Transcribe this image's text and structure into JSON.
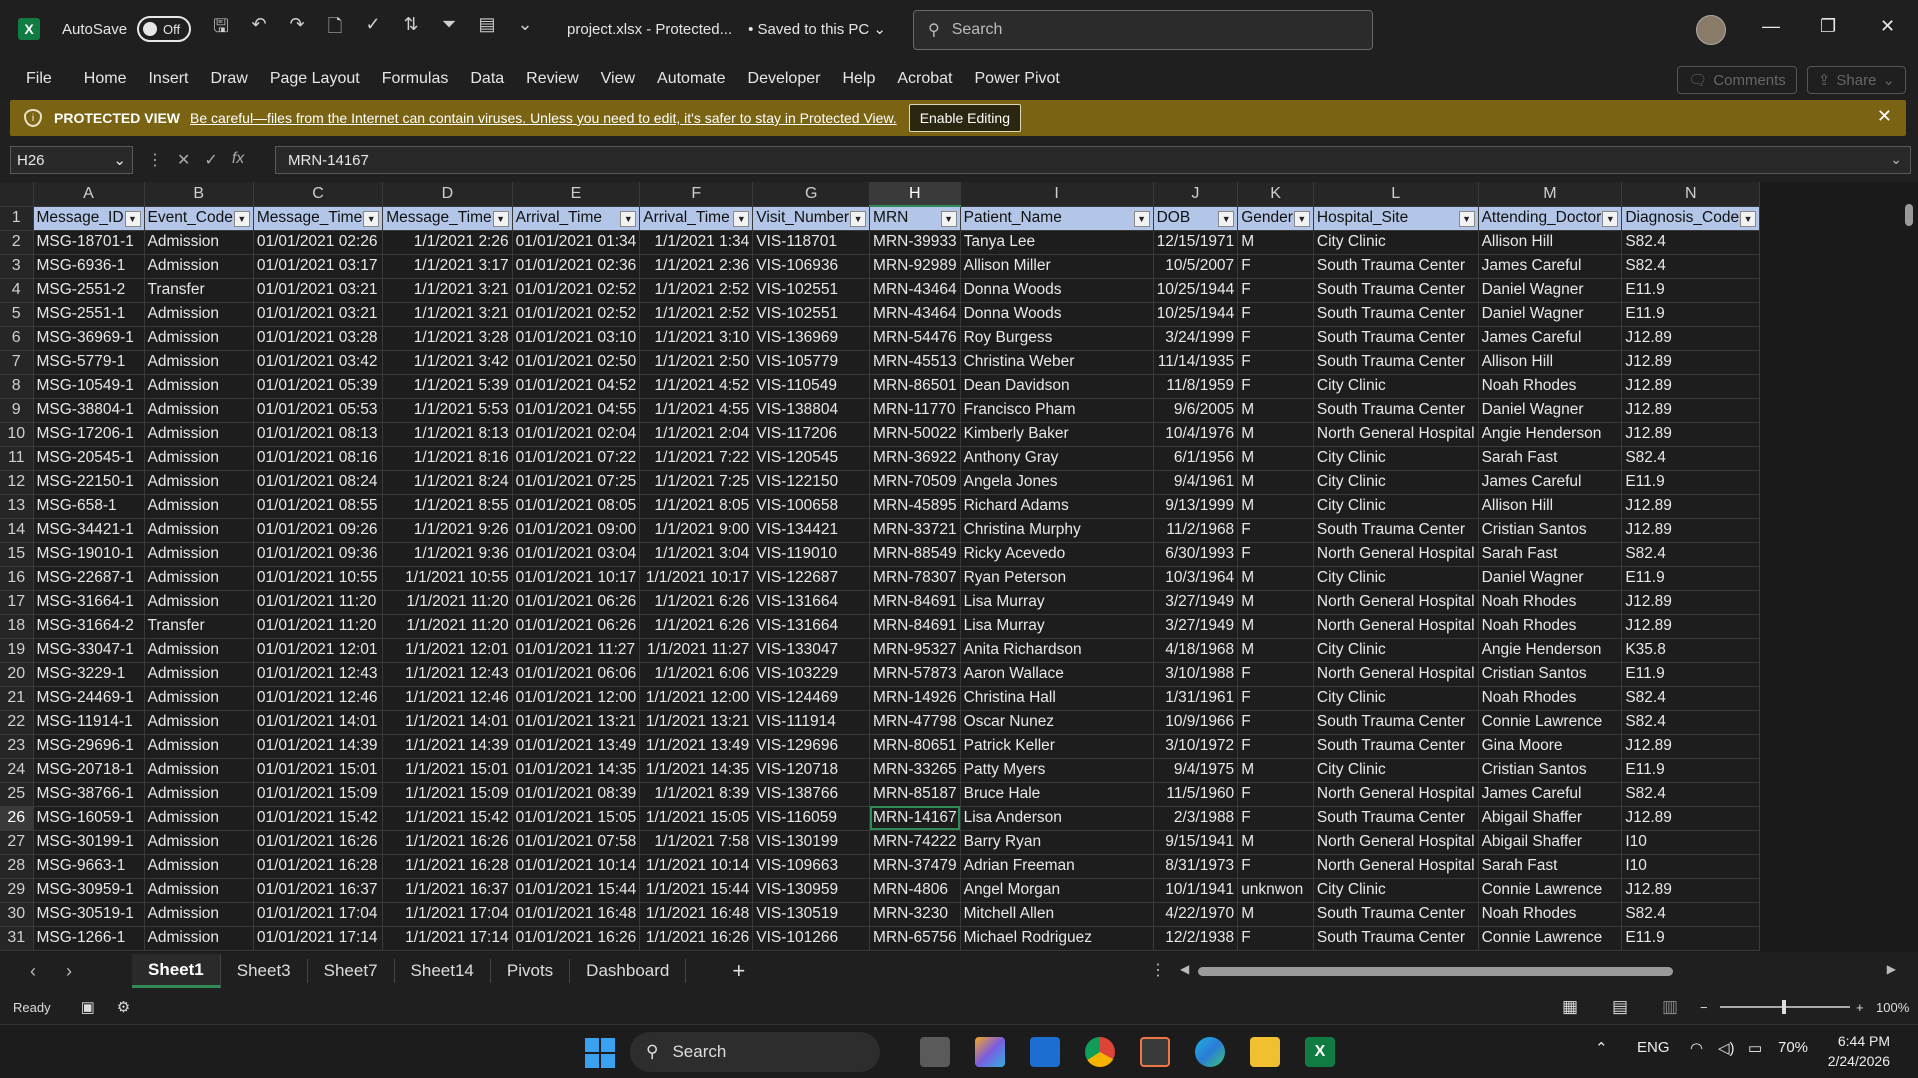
{
  "titlebar": {
    "autosave_label": "AutoSave",
    "autosave_state": "Off",
    "filename": "project.xlsx  -  Protected...",
    "save_status": "•  Saved to this PC ⌄",
    "search_placeholder": "Search",
    "minimize_icon": "—",
    "restore_icon": "❐",
    "close_icon": "✕"
  },
  "menu": [
    "File",
    "Home",
    "Insert",
    "Draw",
    "Page Layout",
    "Formulas",
    "Data",
    "Review",
    "View",
    "Automate",
    "Developer",
    "Help",
    "Acrobat",
    "Power Pivot"
  ],
  "menu_buttons": {
    "comments": "Comments",
    "share": "Share"
  },
  "protected_view": {
    "title": "PROTECTED VIEW",
    "message": "Be careful—files from the Internet can contain viruses. Unless you need to edit, it's safer to stay in Protected View.",
    "button": "Enable Editing",
    "bg_color": "#7a6312"
  },
  "formula_bar": {
    "name_box": "H26",
    "fx": "fx",
    "value": "MRN-14167"
  },
  "columns": [
    "A",
    "B",
    "C",
    "D",
    "E",
    "F",
    "G",
    "H",
    "I",
    "J",
    "K",
    "L",
    "M",
    "N"
  ],
  "selected_column": "H",
  "header_row": [
    "Message_ID",
    "Event_Code",
    "Message_Time",
    "Message_Time",
    "Arrival_Time",
    "Arrival_Time",
    "Visit_Number",
    "MRN",
    "Patient_Name",
    "DOB",
    "Gender",
    "Hospital_Site",
    "Attending_Doctor",
    "Diagnosis_Code"
  ],
  "rows": [
    [
      "MSG-18701-1",
      "Admission",
      "01/01/2021 02:26",
      "1/1/2021 2:26",
      "01/01/2021 01:34",
      "1/1/2021 1:34",
      "VIS-118701",
      "MRN-39933",
      "Tanya Lee",
      "12/15/1971",
      "M",
      "City Clinic",
      "Allison Hill",
      "S82.4"
    ],
    [
      "MSG-6936-1",
      "Admission",
      "01/01/2021 03:17",
      "1/1/2021 3:17",
      "01/01/2021 02:36",
      "1/1/2021 2:36",
      "VIS-106936",
      "MRN-92989",
      "Allison Miller",
      "10/5/2007",
      "F",
      "South Trauma Center",
      "James Careful",
      "S82.4"
    ],
    [
      "MSG-2551-2",
      "Transfer",
      "01/01/2021 03:21",
      "1/1/2021 3:21",
      "01/01/2021 02:52",
      "1/1/2021 2:52",
      "VIS-102551",
      "MRN-43464",
      "Donna Woods",
      "10/25/1944",
      "F",
      "South Trauma Center",
      "Daniel Wagner",
      "E11.9"
    ],
    [
      "MSG-2551-1",
      "Admission",
      "01/01/2021 03:21",
      "1/1/2021 3:21",
      "01/01/2021 02:52",
      "1/1/2021 2:52",
      "VIS-102551",
      "MRN-43464",
      "Donna Woods",
      "10/25/1944",
      "F",
      "South Trauma Center",
      "Daniel Wagner",
      "E11.9"
    ],
    [
      "MSG-36969-1",
      "Admission",
      "01/01/2021 03:28",
      "1/1/2021 3:28",
      "01/01/2021 03:10",
      "1/1/2021 3:10",
      "VIS-136969",
      "MRN-54476",
      "Roy Burgess",
      "3/24/1999",
      "F",
      "South Trauma Center",
      "James Careful",
      "J12.89"
    ],
    [
      "MSG-5779-1",
      "Admission",
      "01/01/2021 03:42",
      "1/1/2021 3:42",
      "01/01/2021 02:50",
      "1/1/2021 2:50",
      "VIS-105779",
      "MRN-45513",
      "Christina Weber",
      "11/14/1935",
      "F",
      "South Trauma Center",
      "Allison Hill",
      "J12.89"
    ],
    [
      "MSG-10549-1",
      "Admission",
      "01/01/2021 05:39",
      "1/1/2021 5:39",
      "01/01/2021 04:52",
      "1/1/2021 4:52",
      "VIS-110549",
      "MRN-86501",
      "Dean Davidson",
      "11/8/1959",
      "F",
      "City Clinic",
      "Noah Rhodes",
      "J12.89"
    ],
    [
      "MSG-38804-1",
      "Admission",
      "01/01/2021 05:53",
      "1/1/2021 5:53",
      "01/01/2021 04:55",
      "1/1/2021 4:55",
      "VIS-138804",
      "MRN-11770",
      "Francisco Pham",
      "9/6/2005",
      "M",
      "South Trauma Center",
      "Daniel Wagner",
      "J12.89"
    ],
    [
      "MSG-17206-1",
      "Admission",
      "01/01/2021 08:13",
      "1/1/2021 8:13",
      "01/01/2021 02:04",
      "1/1/2021 2:04",
      "VIS-117206",
      "MRN-50022",
      "Kimberly Baker",
      "10/4/1976",
      "M",
      "North General Hospital",
      "Angie Henderson",
      "J12.89"
    ],
    [
      "MSG-20545-1",
      "Admission",
      "01/01/2021 08:16",
      "1/1/2021 8:16",
      "01/01/2021 07:22",
      "1/1/2021 7:22",
      "VIS-120545",
      "MRN-36922",
      "Anthony Gray",
      "6/1/1956",
      "M",
      "City Clinic",
      "Sarah Fast",
      "S82.4"
    ],
    [
      "MSG-22150-1",
      "Admission",
      "01/01/2021 08:24",
      "1/1/2021 8:24",
      "01/01/2021 07:25",
      "1/1/2021 7:25",
      "VIS-122150",
      "MRN-70509",
      "Angela Jones",
      "9/4/1961",
      "M",
      "City Clinic",
      "James Careful",
      "E11.9"
    ],
    [
      "MSG-658-1",
      "Admission",
      "01/01/2021 08:55",
      "1/1/2021 8:55",
      "01/01/2021 08:05",
      "1/1/2021 8:05",
      "VIS-100658",
      "MRN-45895",
      "Richard Adams",
      "9/13/1999",
      "M",
      "City Clinic",
      "Allison Hill",
      "J12.89"
    ],
    [
      "MSG-34421-1",
      "Admission",
      "01/01/2021 09:26",
      "1/1/2021 9:26",
      "01/01/2021 09:00",
      "1/1/2021 9:00",
      "VIS-134421",
      "MRN-33721",
      "Christina Murphy",
      "11/2/1968",
      "F",
      "South Trauma Center",
      "Cristian Santos",
      "J12.89"
    ],
    [
      "MSG-19010-1",
      "Admission",
      "01/01/2021 09:36",
      "1/1/2021 9:36",
      "01/01/2021 03:04",
      "1/1/2021 3:04",
      "VIS-119010",
      "MRN-88549",
      "Ricky Acevedo",
      "6/30/1993",
      "F",
      "North General Hospital",
      "Sarah Fast",
      "S82.4"
    ],
    [
      "MSG-22687-1",
      "Admission",
      "01/01/2021 10:55",
      "1/1/2021 10:55",
      "01/01/2021 10:17",
      "1/1/2021 10:17",
      "VIS-122687",
      "MRN-78307",
      "Ryan Peterson",
      "10/3/1964",
      "M",
      "City Clinic",
      "Daniel Wagner",
      "E11.9"
    ],
    [
      "MSG-31664-1",
      "Admission",
      "01/01/2021 11:20",
      "1/1/2021 11:20",
      "01/01/2021 06:26",
      "1/1/2021 6:26",
      "VIS-131664",
      "MRN-84691",
      "Lisa Murray",
      "3/27/1949",
      "M",
      "North General Hospital",
      "Noah Rhodes",
      "J12.89"
    ],
    [
      "MSG-31664-2",
      "Transfer",
      "01/01/2021 11:20",
      "1/1/2021 11:20",
      "01/01/2021 06:26",
      "1/1/2021 6:26",
      "VIS-131664",
      "MRN-84691",
      "Lisa Murray",
      "3/27/1949",
      "M",
      "North General Hospital",
      "Noah Rhodes",
      "J12.89"
    ],
    [
      "MSG-33047-1",
      "Admission",
      "01/01/2021 12:01",
      "1/1/2021 12:01",
      "01/01/2021 11:27",
      "1/1/2021 11:27",
      "VIS-133047",
      "MRN-95327",
      "Anita Richardson",
      "4/18/1968",
      "M",
      "City Clinic",
      "Angie Henderson",
      "K35.8"
    ],
    [
      "MSG-3229-1",
      "Admission",
      "01/01/2021 12:43",
      "1/1/2021 12:43",
      "01/01/2021 06:06",
      "1/1/2021 6:06",
      "VIS-103229",
      "MRN-57873",
      "Aaron Wallace",
      "3/10/1988",
      "F",
      "North General Hospital",
      "Cristian Santos",
      "E11.9"
    ],
    [
      "MSG-24469-1",
      "Admission",
      "01/01/2021 12:46",
      "1/1/2021 12:46",
      "01/01/2021 12:00",
      "1/1/2021 12:00",
      "VIS-124469",
      "MRN-14926",
      "Christina Hall",
      "1/31/1961",
      "F",
      "City Clinic",
      "Noah Rhodes",
      "S82.4"
    ],
    [
      "MSG-11914-1",
      "Admission",
      "01/01/2021 14:01",
      "1/1/2021 14:01",
      "01/01/2021 13:21",
      "1/1/2021 13:21",
      "VIS-111914",
      "MRN-47798",
      "Oscar Nunez",
      "10/9/1966",
      "F",
      "South Trauma Center",
      "Connie Lawrence",
      "S82.4"
    ],
    [
      "MSG-29696-1",
      "Admission",
      "01/01/2021 14:39",
      "1/1/2021 14:39",
      "01/01/2021 13:49",
      "1/1/2021 13:49",
      "VIS-129696",
      "MRN-80651",
      "Patrick Keller",
      "3/10/1972",
      "F",
      "South Trauma Center",
      "Gina Moore",
      "J12.89"
    ],
    [
      "MSG-20718-1",
      "Admission",
      "01/01/2021 15:01",
      "1/1/2021 15:01",
      "01/01/2021 14:35",
      "1/1/2021 14:35",
      "VIS-120718",
      "MRN-33265",
      "Patty Myers",
      "9/4/1975",
      "M",
      "City Clinic",
      "Cristian Santos",
      "E11.9"
    ],
    [
      "MSG-38766-1",
      "Admission",
      "01/01/2021 15:09",
      "1/1/2021 15:09",
      "01/01/2021 08:39",
      "1/1/2021 8:39",
      "VIS-138766",
      "MRN-85187",
      "Bruce Hale",
      "11/5/1960",
      "F",
      "North General Hospital",
      "James Careful",
      "S82.4"
    ],
    [
      "MSG-16059-1",
      "Admission",
      "01/01/2021 15:42",
      "1/1/2021 15:42",
      "01/01/2021 15:05",
      "1/1/2021 15:05",
      "VIS-116059",
      "MRN-14167",
      "Lisa Anderson",
      "2/3/1988",
      "F",
      "South Trauma Center",
      "Abigail Shaffer",
      "J12.89"
    ],
    [
      "MSG-30199-1",
      "Admission",
      "01/01/2021 16:26",
      "1/1/2021 16:26",
      "01/01/2021 07:58",
      "1/1/2021 7:58",
      "VIS-130199",
      "MRN-74222",
      "Barry Ryan",
      "9/15/1941",
      "M",
      "North General Hospital",
      "Abigail Shaffer",
      "I10"
    ],
    [
      "MSG-9663-1",
      "Admission",
      "01/01/2021 16:28",
      "1/1/2021 16:28",
      "01/01/2021 10:14",
      "1/1/2021 10:14",
      "VIS-109663",
      "MRN-37479",
      "Adrian Freeman",
      "8/31/1973",
      "F",
      "North General Hospital",
      "Sarah Fast",
      "I10"
    ],
    [
      "MSG-30959-1",
      "Admission",
      "01/01/2021 16:37",
      "1/1/2021 16:37",
      "01/01/2021 15:44",
      "1/1/2021 15:44",
      "VIS-130959",
      "MRN-4806",
      "Angel Morgan",
      "10/1/1941",
      "unknwon",
      "City Clinic",
      "Connie Lawrence",
      "J12.89"
    ],
    [
      "MSG-30519-1",
      "Admission",
      "01/01/2021 17:04",
      "1/1/2021 17:04",
      "01/01/2021 16:48",
      "1/1/2021 16:48",
      "VIS-130519",
      "MRN-3230",
      "Mitchell Allen",
      "4/22/1970",
      "M",
      "South Trauma Center",
      "Noah Rhodes",
      "S82.4"
    ],
    [
      "MSG-1266-1",
      "Admission",
      "01/01/2021 17:14",
      "1/1/2021 17:14",
      "01/01/2021 16:26",
      "1/1/2021 16:26",
      "VIS-101266",
      "MRN-65756",
      "Michael Rodriguez",
      "12/2/1938",
      "F",
      "South Trauma Center",
      "Connie Lawrence",
      "E11.9"
    ]
  ],
  "active_cell": {
    "row": 26,
    "col": "H"
  },
  "sheet_tabs": [
    "Sheet1",
    "Sheet3",
    "Sheet7",
    "Sheet14",
    "Pivots",
    "Dashboard"
  ],
  "active_tab": "Sheet1",
  "add_sheet": "+",
  "status": {
    "ready": "Ready",
    "zoom": "100%"
  },
  "taskbar": {
    "search": "Search",
    "language": "ENG",
    "battery": "70%",
    "time": "6:44 PM",
    "date": "2/24/2026"
  },
  "colors": {
    "header_fill": "#b4c6e7",
    "accent_green": "#2f8a55",
    "excel_green": "#107c41"
  }
}
